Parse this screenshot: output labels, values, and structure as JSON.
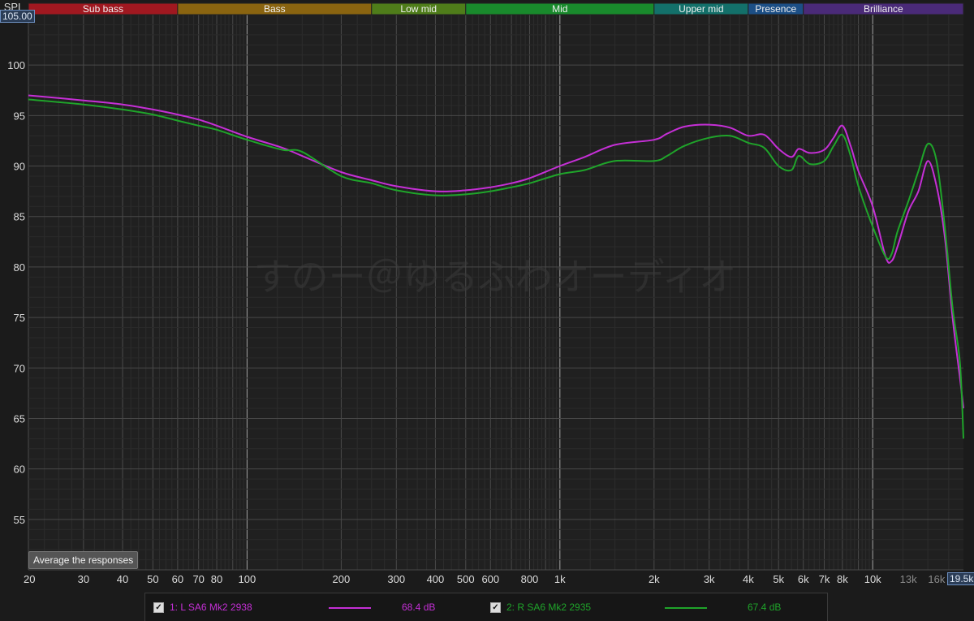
{
  "watermark": "すのー＠ゆるふわオーディオ",
  "corner": {
    "spl_label": "SPL",
    "ymax_value": "105.00",
    "xmax_value": "19.5k"
  },
  "bands": [
    {
      "label": "Sub bass",
      "from": 20,
      "to": 60,
      "color": "#a01820"
    },
    {
      "label": "Bass",
      "from": 60,
      "to": 250,
      "color": "#8a6410"
    },
    {
      "label": "Low mid",
      "from": 250,
      "to": 500,
      "color": "#4f7d1a"
    },
    {
      "label": "Mid",
      "from": 500,
      "to": 2000,
      "color": "#198a2c"
    },
    {
      "label": "Upper mid",
      "from": 2000,
      "to": 4000,
      "color": "#13706a"
    },
    {
      "label": "Presence",
      "from": 4000,
      "to": 6000,
      "color": "#1c4f86"
    },
    {
      "label": "Brilliance",
      "from": 6000,
      "to": 20000,
      "color": "#4a2a78"
    }
  ],
  "average_button": "Average the responses",
  "legend": [
    {
      "label": "1: L SA6 Mk2 2938",
      "value": "68.4 dB",
      "color": "#c52fd6",
      "checked": "✓"
    },
    {
      "label": "2: R SA6 Mk2 2935",
      "value": "67.4 dB",
      "color": "#1fa42a",
      "checked": "✓"
    }
  ],
  "chart_data": {
    "type": "line",
    "xlabel": "",
    "ylabel": "SPL",
    "x_scale": "log",
    "xlim": [
      20,
      19500
    ],
    "ylim": [
      50,
      105
    ],
    "grid": true,
    "x_ticks": [
      {
        "v": 20,
        "t": "20"
      },
      {
        "v": 30,
        "t": "30"
      },
      {
        "v": 40,
        "t": "40"
      },
      {
        "v": 50,
        "t": "50"
      },
      {
        "v": 60,
        "t": "60"
      },
      {
        "v": 70,
        "t": "70"
      },
      {
        "v": 80,
        "t": "80"
      },
      {
        "v": 100,
        "t": "100"
      },
      {
        "v": 200,
        "t": "200"
      },
      {
        "v": 300,
        "t": "300"
      },
      {
        "v": 400,
        "t": "400"
      },
      {
        "v": 500,
        "t": "500"
      },
      {
        "v": 600,
        "t": "600"
      },
      {
        "v": 800,
        "t": "800"
      },
      {
        "v": 1000,
        "t": "1k"
      },
      {
        "v": 2000,
        "t": "2k"
      },
      {
        "v": 3000,
        "t": "3k"
      },
      {
        "v": 4000,
        "t": "4k"
      },
      {
        "v": 5000,
        "t": "5k"
      },
      {
        "v": 6000,
        "t": "6k"
      },
      {
        "v": 7000,
        "t": "7k"
      },
      {
        "v": 8000,
        "t": "8k"
      },
      {
        "v": 10000,
        "t": "10k"
      },
      {
        "v": 13000,
        "t": "13k",
        "dim": true
      },
      {
        "v": 16000,
        "t": "16k",
        "dim": true
      }
    ],
    "y_ticks": [
      55,
      60,
      65,
      70,
      75,
      80,
      85,
      90,
      95,
      100
    ],
    "series": [
      {
        "name": "1: L SA6 Mk2 2938",
        "color": "#c52fd6",
        "points": [
          [
            20,
            97.0
          ],
          [
            30,
            96.5
          ],
          [
            40,
            96.1
          ],
          [
            50,
            95.6
          ],
          [
            60,
            95.1
          ],
          [
            70,
            94.6
          ],
          [
            80,
            94.0
          ],
          [
            100,
            92.9
          ],
          [
            130,
            91.8
          ],
          [
            150,
            91.0
          ],
          [
            200,
            89.4
          ],
          [
            250,
            88.6
          ],
          [
            300,
            88.0
          ],
          [
            400,
            87.5
          ],
          [
            500,
            87.6
          ],
          [
            600,
            87.9
          ],
          [
            700,
            88.3
          ],
          [
            800,
            88.8
          ],
          [
            1000,
            90.0
          ],
          [
            1200,
            90.9
          ],
          [
            1500,
            92.1
          ],
          [
            2000,
            92.6
          ],
          [
            2200,
            93.2
          ],
          [
            2500,
            93.9
          ],
          [
            3000,
            94.1
          ],
          [
            3500,
            93.8
          ],
          [
            4000,
            93.0
          ],
          [
            4500,
            93.1
          ],
          [
            5000,
            91.7
          ],
          [
            5500,
            90.9
          ],
          [
            5800,
            91.7
          ],
          [
            6300,
            91.3
          ],
          [
            7000,
            91.6
          ],
          [
            7500,
            92.8
          ],
          [
            8000,
            94.0
          ],
          [
            8500,
            92.0
          ],
          [
            9000,
            89.5
          ],
          [
            10000,
            86.0
          ],
          [
            11000,
            81.0
          ],
          [
            11500,
            80.6
          ],
          [
            12000,
            82.0
          ],
          [
            13000,
            85.5
          ],
          [
            14000,
            87.5
          ],
          [
            15000,
            90.5
          ],
          [
            16000,
            88.0
          ],
          [
            17000,
            83.0
          ],
          [
            18000,
            75.0
          ],
          [
            19000,
            69.0
          ],
          [
            19500,
            66.0
          ]
        ]
      },
      {
        "name": "2: R SA6 Mk2 2935",
        "color": "#1fa42a",
        "points": [
          [
            20,
            96.6
          ],
          [
            30,
            96.1
          ],
          [
            40,
            95.6
          ],
          [
            50,
            95.1
          ],
          [
            60,
            94.5
          ],
          [
            70,
            94.0
          ],
          [
            80,
            93.6
          ],
          [
            100,
            92.6
          ],
          [
            130,
            91.6
          ],
          [
            150,
            91.4
          ],
          [
            200,
            89.0
          ],
          [
            250,
            88.3
          ],
          [
            300,
            87.6
          ],
          [
            400,
            87.1
          ],
          [
            500,
            87.2
          ],
          [
            600,
            87.5
          ],
          [
            700,
            87.9
          ],
          [
            800,
            88.3
          ],
          [
            1000,
            89.2
          ],
          [
            1200,
            89.6
          ],
          [
            1500,
            90.5
          ],
          [
            2000,
            90.5
          ],
          [
            2200,
            91.0
          ],
          [
            2500,
            92.0
          ],
          [
            3000,
            92.8
          ],
          [
            3500,
            93.0
          ],
          [
            4000,
            92.3
          ],
          [
            4500,
            91.8
          ],
          [
            5000,
            90.0
          ],
          [
            5500,
            89.6
          ],
          [
            5800,
            91.0
          ],
          [
            6300,
            90.2
          ],
          [
            7000,
            90.5
          ],
          [
            7500,
            92.0
          ],
          [
            8000,
            93.1
          ],
          [
            8500,
            91.0
          ],
          [
            9000,
            88.0
          ],
          [
            10000,
            84.0
          ],
          [
            11000,
            81.0
          ],
          [
            11500,
            81.3
          ],
          [
            12000,
            83.5
          ],
          [
            13000,
            86.5
          ],
          [
            14000,
            89.5
          ],
          [
            15000,
            92.2
          ],
          [
            16000,
            90.5
          ],
          [
            17000,
            84.0
          ],
          [
            18000,
            76.0
          ],
          [
            19000,
            70.5
          ],
          [
            19500,
            63.0
          ]
        ]
      }
    ]
  }
}
